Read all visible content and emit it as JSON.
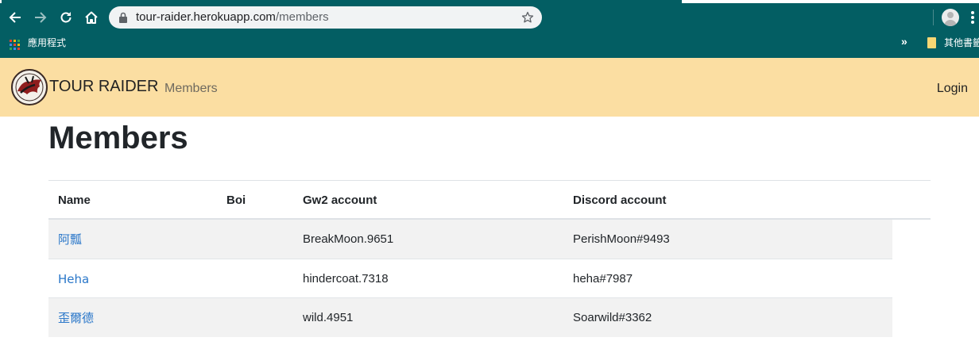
{
  "browser": {
    "url_host": "tour-raider.herokuapp.com",
    "url_path": "/members",
    "bookmarks_bar": {
      "apps_label": "應用程式",
      "other_bookmarks_label": "其他書籤"
    },
    "icons": [
      "back-arrow-icon",
      "forward-arrow-icon",
      "reload-icon",
      "home-icon",
      "lock-icon",
      "star-icon",
      "profile-avatar-icon",
      "menu-kebab-icon",
      "apps-grid-icon",
      "chevron-double-right-icon",
      "folder-icon"
    ],
    "chrome_color": "#035e63"
  },
  "navbar": {
    "brand": "TOUR RAIDER",
    "links": [
      {
        "label": "Members"
      }
    ],
    "login_label": "Login",
    "background_color": "#fbdea2"
  },
  "main": {
    "title": "Members",
    "table": {
      "headers": [
        "Name",
        "Boi",
        "Gw2 account",
        "Discord account"
      ],
      "rows": [
        {
          "name": "阿瓢",
          "boi": "",
          "gw2": "BreakMoon.9651",
          "discord": "PerishMoon#9493"
        },
        {
          "name": "Heha",
          "boi": "",
          "gw2": "hindercoat.7318",
          "discord": "heha#7987"
        },
        {
          "name": "歪爾德",
          "boi": "",
          "gw2": "wild.4951",
          "discord": "Soarwild#3362"
        }
      ],
      "link_color": "#2a77c9"
    }
  }
}
